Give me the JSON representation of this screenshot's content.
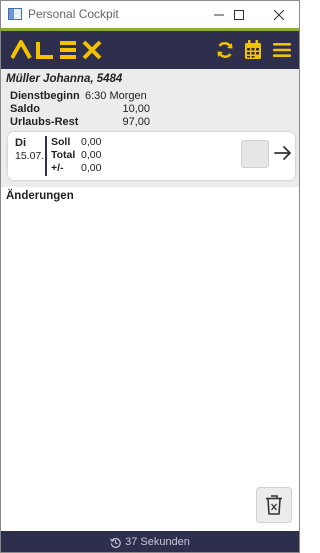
{
  "window": {
    "title": "Personal Cockpit"
  },
  "header": {
    "logo_text": "ALEX",
    "brand_color": "#2e2e4d",
    "accent_color": "#f2c200",
    "stripe_color": "#8bb02e",
    "icons": [
      "refresh-icon",
      "calendar-icon",
      "menu-icon"
    ]
  },
  "employee": {
    "name": "Müller Johanna, 5484"
  },
  "info": {
    "dienstbeginn_label": "Dienstbeginn",
    "dienstbeginn_value": "6:30 Morgen",
    "saldo_label": "Saldo",
    "saldo_value": "10,00",
    "urlaub_label": "Urlaubs-Rest",
    "urlaub_value": "97,00"
  },
  "day_card": {
    "day": "Di",
    "date": "15.07.",
    "soll_label": "Soll",
    "soll_value": "0,00",
    "total_label": "Total",
    "total_value": "0,00",
    "diff_label": "+/-",
    "diff_value": "0,00"
  },
  "changes": {
    "title": "Änderungen"
  },
  "footer": {
    "timer_text": "37 Sekunden"
  }
}
